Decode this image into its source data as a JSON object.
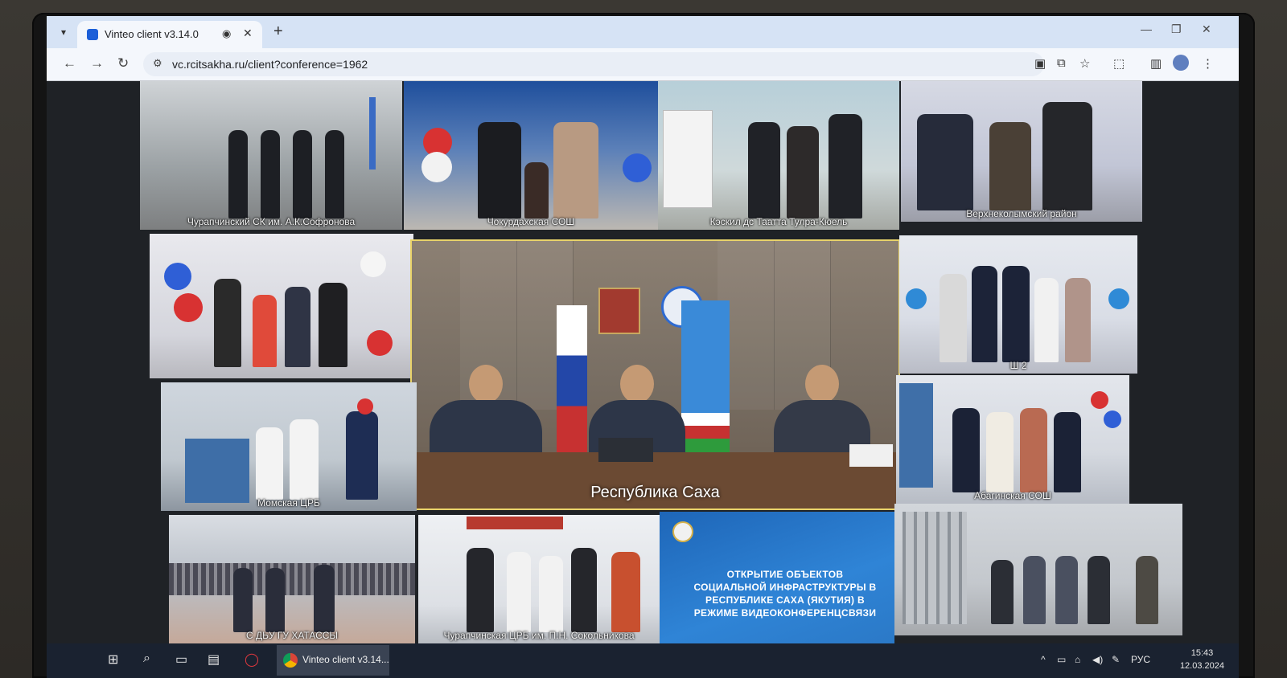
{
  "browser": {
    "tab_title": "Vinteo client v3.14.0",
    "tab_search_icon": "chevron-down-icon",
    "url": "vc.rcitsakha.ru/client?conference=1962"
  },
  "conference": {
    "tiles": [
      {
        "caption": "Чурапчинский СК им. А.К.Софронова"
      },
      {
        "caption": "Чокурдахская СОШ"
      },
      {
        "caption": "Кэскил дс Таатта Тулра-Кюель"
      },
      {
        "caption": "Верхнеколымский район"
      },
      {
        "caption": ""
      },
      {
        "caption": "Республика Саха"
      },
      {
        "caption": "Ш 2"
      },
      {
        "caption": "Момская ЦРБ"
      },
      {
        "caption": "Абагинская СОШ"
      },
      {
        "caption": "С ДЬУ ГУ ХАТАССЫ"
      },
      {
        "caption": "Чурапчинская ЦРБ им. П.Н. Сокольникова"
      },
      {
        "caption": "ОТКРЫТИЕ ОБЪЕКТОВ СОЦИАЛЬНОЙ ИНФРАСТРУКТУРЫ В РЕСПУБЛИКЕ САХА (ЯКУТИЯ) В РЕЖИМЕ ВИДЕОКОНФЕРЕНЦСВЯЗИ"
      },
      {
        "caption": ""
      }
    ]
  },
  "taskbar": {
    "app_label": "Vinteo client v3.14...",
    "lang": "РУС",
    "time": "15:43",
    "date": "12.03.2024"
  },
  "colors": {
    "tabstrip": "#d6e3f5",
    "active_speaker_border": "#e9d36a",
    "info_tile": "#2f84d6",
    "taskbar": "#1a2230"
  }
}
